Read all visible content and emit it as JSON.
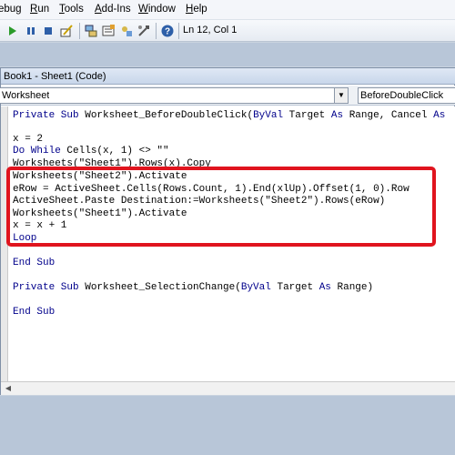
{
  "menu": {
    "items": [
      {
        "label": "ebug",
        "accel": ""
      },
      {
        "label": "Run",
        "accel": "R"
      },
      {
        "label": "Tools",
        "accel": "T"
      },
      {
        "label": "Add-Ins",
        "accel": "A"
      },
      {
        "label": "Window",
        "accel": "W"
      },
      {
        "label": "Help",
        "accel": "H"
      }
    ]
  },
  "toolbar": {
    "icons": [
      "run-icon",
      "break-icon",
      "reset-icon",
      "design-mode-icon",
      "project-explorer-icon",
      "properties-icon",
      "object-browser-icon",
      "toolbox-icon",
      "help-icon"
    ],
    "status": "Ln 12, Col 1"
  },
  "code_window": {
    "title": "Book1 - Sheet1 (Code)",
    "object_combo": "Worksheet",
    "procedure_combo": "BeforeDoubleClick"
  },
  "code": {
    "lines": [
      "Private Sub Worksheet_BeforeDoubleClick(ByVal Target As Range, Cancel As",
      "",
      "x = 2",
      "Do While Cells(x, 1) <> \"\"",
      "Worksheets(\"Sheet1\").Rows(x).Copy",
      "Worksheets(\"Sheet2\").Activate",
      "eRow = ActiveSheet.Cells(Rows.Count, 1).End(xlUp).Offset(1, 0).Row",
      "ActiveSheet.Paste Destination:=Worksheets(\"Sheet2\").Rows(eRow)",
      "Worksheets(\"Sheet1\").Activate",
      "x = x + 1",
      "Loop",
      "",
      "End Sub",
      "",
      "Private Sub Worksheet_SelectionChange(ByVal Target As Range)",
      "",
      "End Sub"
    ]
  },
  "colors": {
    "keyword": "#00008b",
    "highlight": "#e0141e"
  }
}
